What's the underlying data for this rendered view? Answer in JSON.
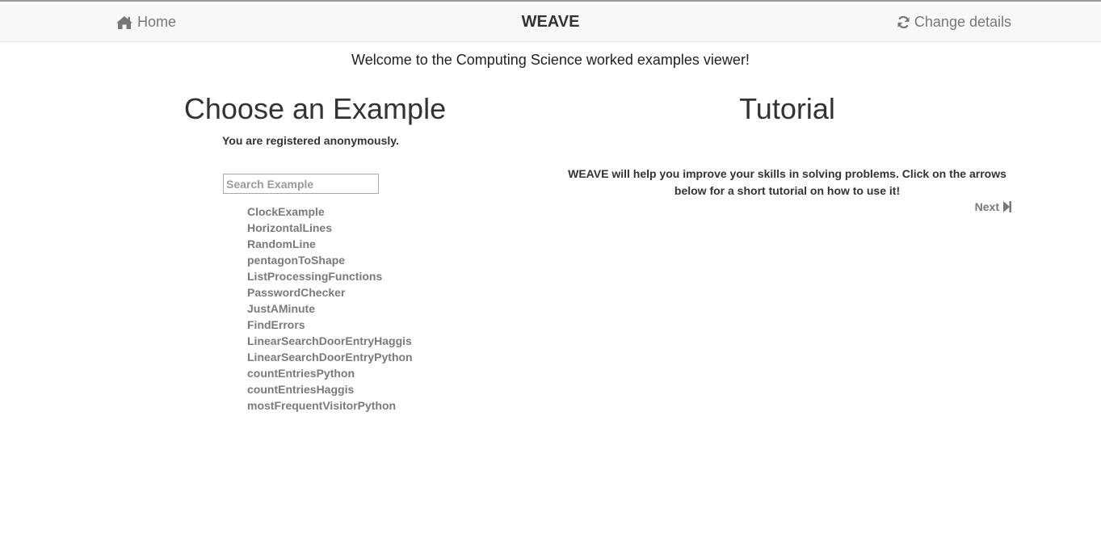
{
  "navbar": {
    "home_label": "Home",
    "brand": "WEAVE",
    "change_details_label": "Change details",
    "home_icon": "home-icon",
    "change_details_icon": "refresh-icon"
  },
  "welcome_text": "Welcome to the Computing Science worked examples viewer!",
  "examples": {
    "title": "Choose an Example",
    "registration_status": "You are registered anonymously.",
    "search_placeholder": "Search Example",
    "search_value": "",
    "items": [
      "ClockExample",
      "HorizontalLines",
      "RandomLine",
      "pentagonToShape",
      "ListProcessingFunctions",
      "PasswordChecker",
      "JustAMinute",
      "FindErrors",
      "LinearSearchDoorEntryHaggis",
      "LinearSearchDoorEntryPython",
      "countEntriesPython",
      "countEntriesHaggis",
      "mostFrequentVisitorPython"
    ]
  },
  "tutorial": {
    "title": "Tutorial",
    "text": "WEAVE will help you improve your skills in solving problems. Click on the arrows below for a short tutorial on how to use it!",
    "next_label": "Next",
    "next_icon": "step-forward-icon"
  }
}
